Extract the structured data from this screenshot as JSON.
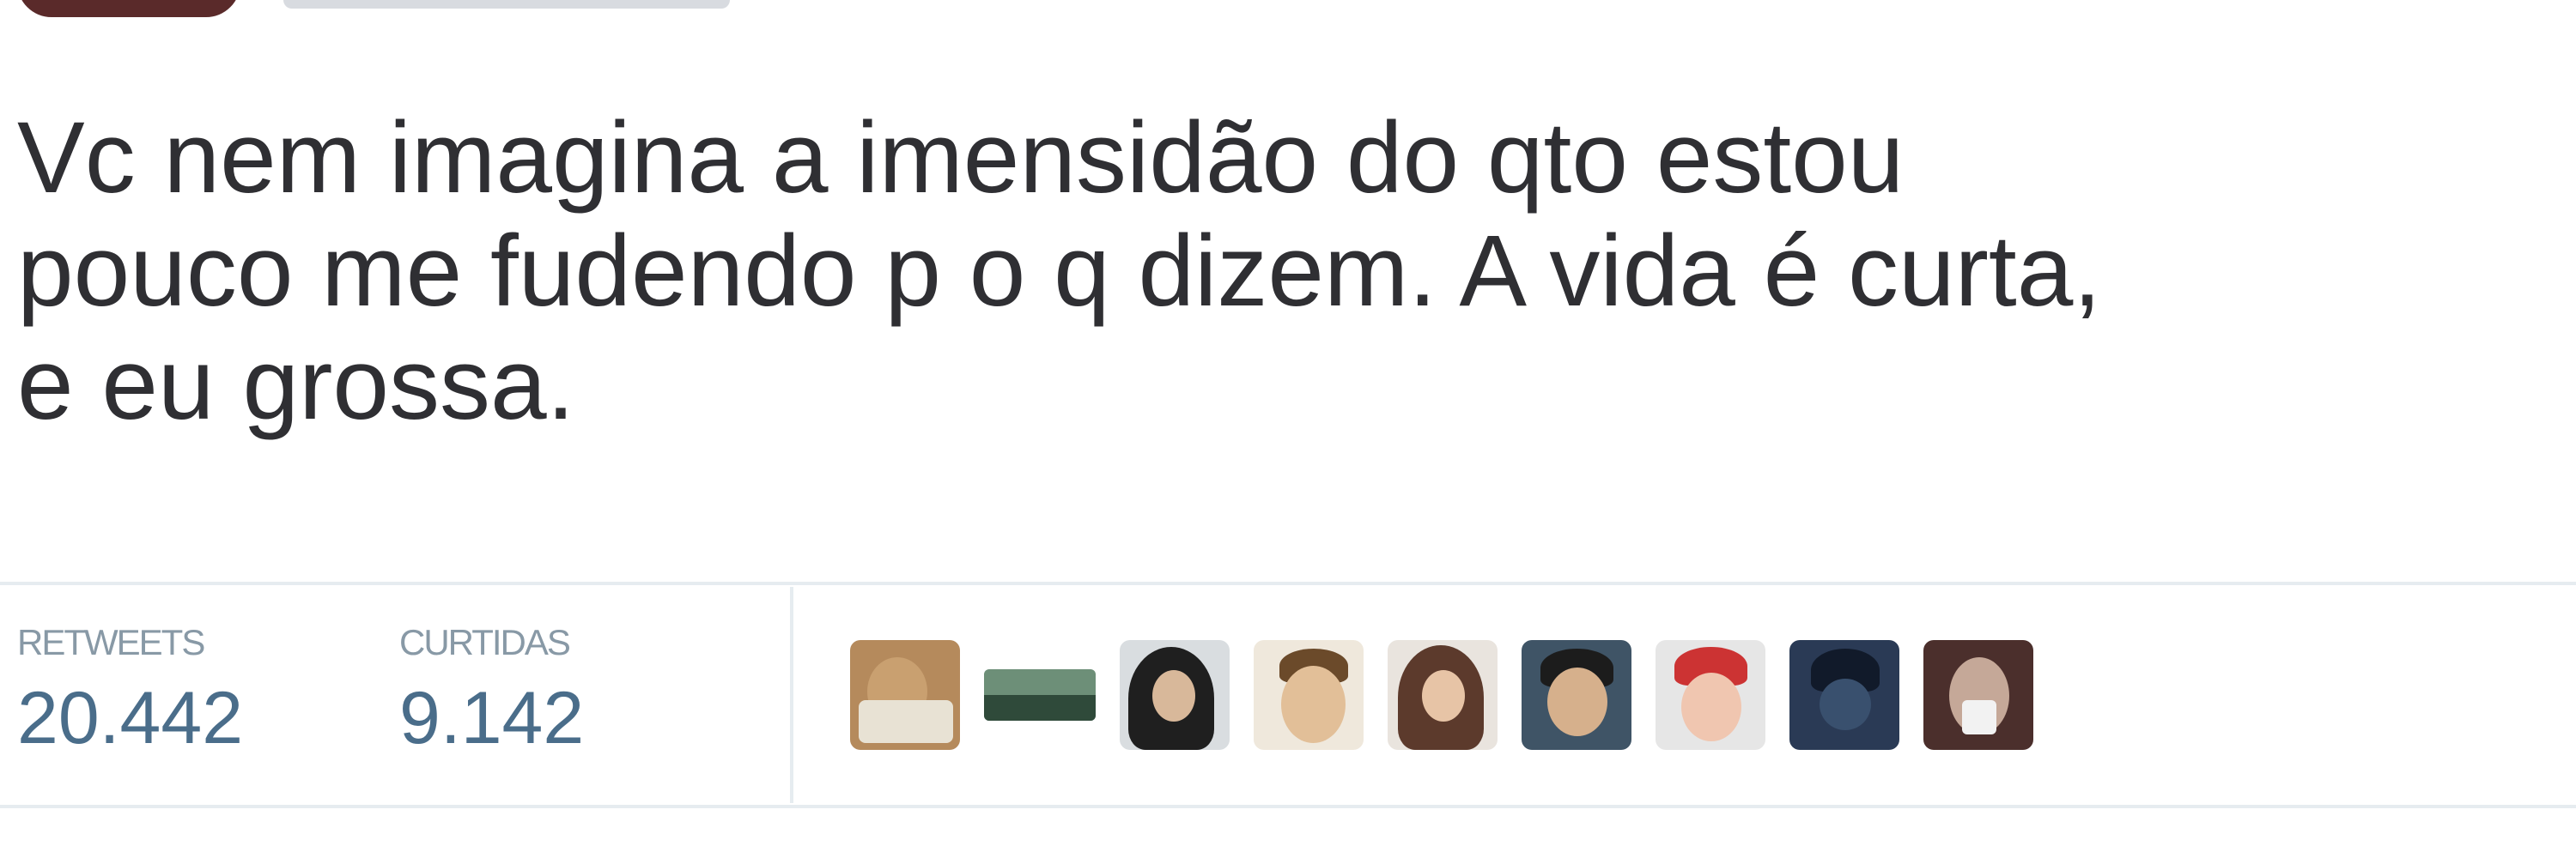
{
  "tweet": {
    "text_lines": [
      "Vc nem imagina a imensidão do qto estou",
      "pouco me fudendo p o q dizem. A vida é curta,",
      "e eu grossa."
    ]
  },
  "stats": {
    "retweets_label": "RETWEETS",
    "retweets_value": "20.442",
    "likes_label": "CURTIDAS",
    "likes_value": "9.142"
  },
  "likers": [
    {
      "name": "liker-avatar-1",
      "color": "#b58a5c"
    },
    {
      "name": "liker-avatar-2",
      "color": "#5f8a6a"
    },
    {
      "name": "liker-avatar-3",
      "color": "#3a3a3a"
    },
    {
      "name": "liker-avatar-4",
      "color": "#c9a57a"
    },
    {
      "name": "liker-avatar-5",
      "color": "#9b6b52"
    },
    {
      "name": "liker-avatar-6",
      "color": "#4a5d6e"
    },
    {
      "name": "liker-avatar-7",
      "color": "#c83a3a"
    },
    {
      "name": "liker-avatar-8",
      "color": "#2e3d5a"
    },
    {
      "name": "liker-avatar-9",
      "color": "#5a3a35"
    }
  ],
  "colors": {
    "text": "#2f2f33",
    "stat_label": "#8899a6",
    "stat_value": "#4a6d8a",
    "divider": "#e6ecf0"
  }
}
